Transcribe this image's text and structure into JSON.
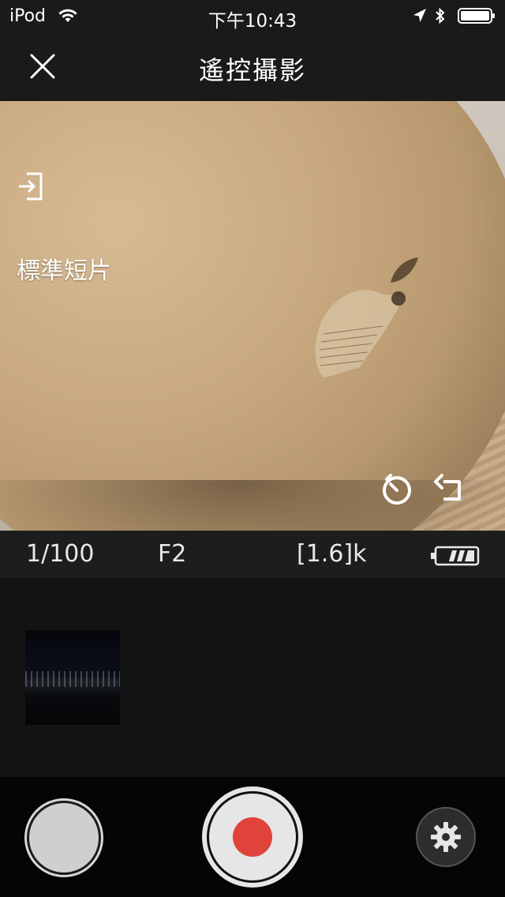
{
  "status_bar": {
    "carrier": "iPod",
    "time": "下午10:43",
    "icons": [
      "wifi-icon",
      "location-arrow-icon",
      "bluetooth-icon",
      "battery-icon"
    ]
  },
  "nav": {
    "title": "遙控攝影",
    "close_icon": "close-icon"
  },
  "viewfinder": {
    "mode_label": "標準短片",
    "icons": [
      "exit-icon",
      "timer-icon",
      "rotate-icon"
    ]
  },
  "info": {
    "shutter": "1/100",
    "aperture": "F2",
    "capacity": "[1.6]k",
    "battery_icon": "camera-battery-icon",
    "battery_level_bars": 3
  },
  "gallery": {
    "thumbnails": [
      {
        "name": "night-city-thumbnail"
      }
    ]
  },
  "controls": {
    "mode_button": "mode-button",
    "record_button": "record-button",
    "settings_icon": "gear-icon",
    "accent_color": "#e0433a"
  }
}
